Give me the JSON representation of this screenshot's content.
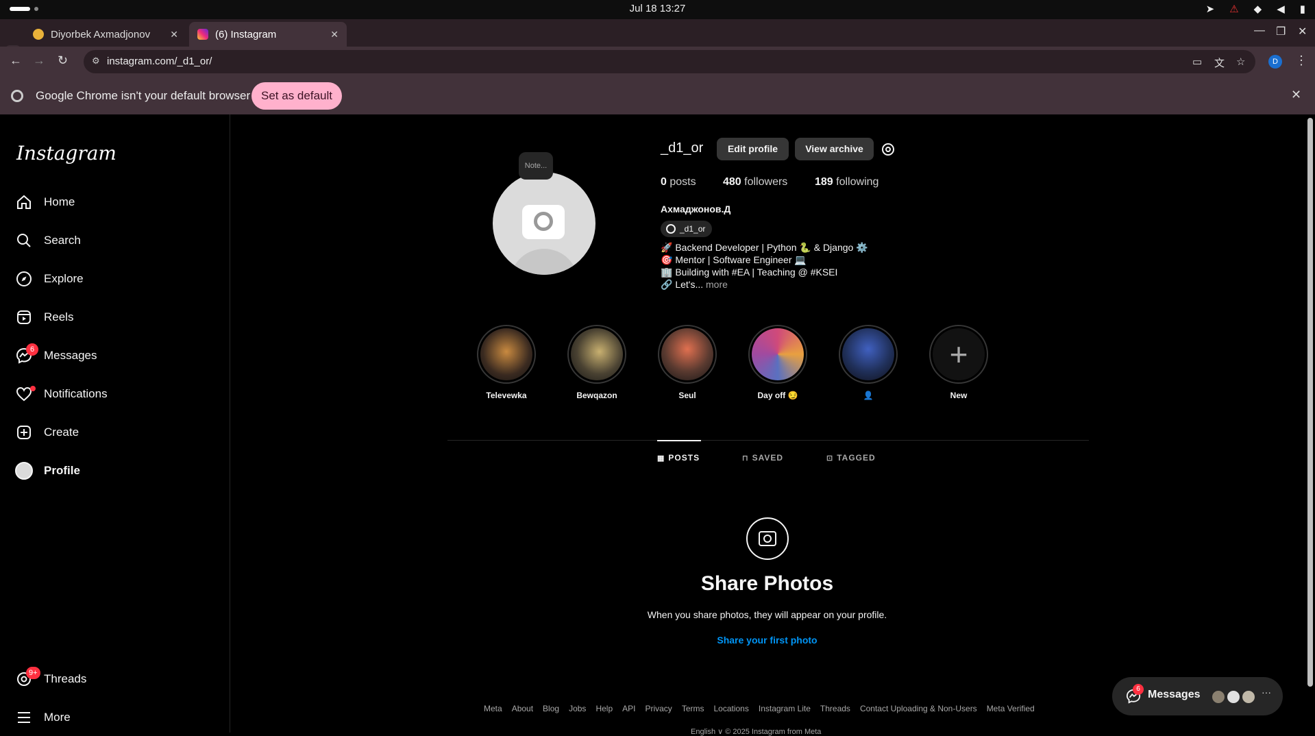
{
  "os": {
    "clock": "Jul 18  13:27"
  },
  "browser": {
    "tabs": [
      {
        "label": "Diyorbek Axmadjonov"
      },
      {
        "label": "(6) Instagram"
      }
    ],
    "url": "instagram.com/_d1_or/",
    "avatar_letter": "D",
    "infobar": {
      "message": "Google Chrome isn't your default browser",
      "action": "Set as default"
    }
  },
  "sidebar": {
    "logo": "Instagram",
    "items": [
      {
        "label": "Home"
      },
      {
        "label": "Search"
      },
      {
        "label": "Explore"
      },
      {
        "label": "Reels"
      },
      {
        "label": "Messages",
        "badge": "6"
      },
      {
        "label": "Notifications"
      },
      {
        "label": "Create"
      },
      {
        "label": "Profile"
      }
    ],
    "bottom": [
      {
        "label": "Threads",
        "badge": "9+"
      },
      {
        "label": "More"
      }
    ]
  },
  "profile": {
    "note": "Note...",
    "username": "_d1_or",
    "edit_profile": "Edit profile",
    "view_archive": "View archive",
    "stats": {
      "posts": "0",
      "posts_label": "posts",
      "followers": "480",
      "followers_label": "followers",
      "following": "189",
      "following_label": "following"
    },
    "full_name": "Ахмаджонов.Д",
    "threads_handle": "_d1_or",
    "bio": [
      "🚀 Backend Developer | Python 🐍 & Django ⚙️",
      "🎯 Mentor | Software Engineer 💻",
      "🏢 Building with #EA | Teaching @ #KSEI",
      "🔗 Let's..."
    ],
    "bio_more": "more"
  },
  "highlights": [
    {
      "label": "Televewka",
      "color": "#3a2a20"
    },
    {
      "label": "Bewqazon",
      "color": "#4a4232"
    },
    {
      "label": "Seul",
      "color": "#5a3a30"
    },
    {
      "label": "Day off 😏",
      "color": "#7a4a70"
    },
    {
      "label": "👤",
      "color": "#20305a"
    },
    {
      "label": "New"
    }
  ],
  "profile_tabs": [
    {
      "label": "POSTS",
      "active": true
    },
    {
      "label": "SAVED"
    },
    {
      "label": "TAGGED"
    }
  ],
  "empty_state": {
    "title": "Share Photos",
    "subtitle": "When you share photos, they will appear on your profile.",
    "link": "Share your first photo"
  },
  "footer": {
    "links": [
      "Meta",
      "About",
      "Blog",
      "Jobs",
      "Help",
      "API",
      "Privacy",
      "Terms",
      "Locations",
      "Instagram Lite",
      "Threads",
      "Contact Uploading & Non-Users",
      "Meta Verified"
    ],
    "bottom": "English ∨     © 2025 Instagram from Meta"
  },
  "messages_pill": {
    "label": "Messages",
    "badge": "6"
  },
  "colors": {
    "accent_blue": "#0095f6",
    "badge_red": "#ff3040",
    "default_btn": "#ffb1cc"
  }
}
